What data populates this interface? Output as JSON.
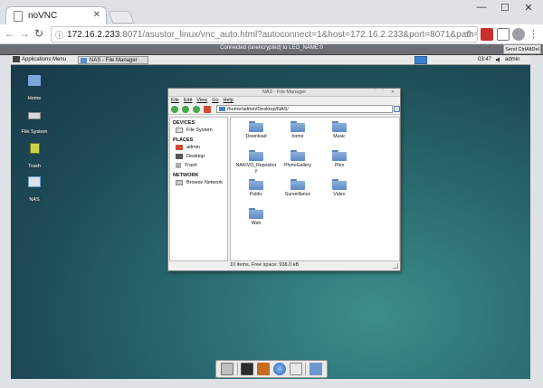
{
  "browser": {
    "tab_title": "noVNC",
    "url_host": "172.16.2.233",
    "url_rest": ":8071/asustor_linux/vnc_auto.html?autoconnect=1&host=172.16.2.233&port=8071&path=...",
    "window_controls": [
      "—",
      "☐",
      "✕"
    ]
  },
  "vnc": {
    "status": "Connected (unencrypted) to LEO_NAME:0",
    "send_cad": "Send CtrlAltDel"
  },
  "panel": {
    "app_menu": "Applications Menu",
    "task": "NAS - File Manager",
    "clock": "03:47",
    "user": "admin"
  },
  "desktop_icons": [
    {
      "label": "Home",
      "icon": "home-folder-icon"
    },
    {
      "label": "File System",
      "icon": "drive-icon"
    },
    {
      "label": "Trash",
      "icon": "trash-icon"
    },
    {
      "label": "NAS",
      "icon": "folder-icon"
    }
  ],
  "file_manager": {
    "title": "NAS - File Manager",
    "menus": [
      "File",
      "Edit",
      "View",
      "Go",
      "Help"
    ],
    "path": "/home/admin/Desktop/NAS/",
    "sidebar": {
      "devices_header": "DEVICES",
      "devices": [
        "File System"
      ],
      "places_header": "PLACES",
      "places": [
        "admin",
        "Desktop",
        "Trash"
      ],
      "network_header": "NETWORK",
      "network": [
        "Browse Network"
      ]
    },
    "files": [
      "Download",
      "home",
      "Music",
      "NAKIVO_Repository",
      "PhotoGallery",
      "Plex",
      "Public",
      "Surveillance",
      "Video",
      "Web"
    ],
    "status": "10 items, Free space: 938.0 kB"
  },
  "colors": {
    "folder": "#6f97cf",
    "desktop": "#2a6b70",
    "panel": "#e9e9e9"
  }
}
